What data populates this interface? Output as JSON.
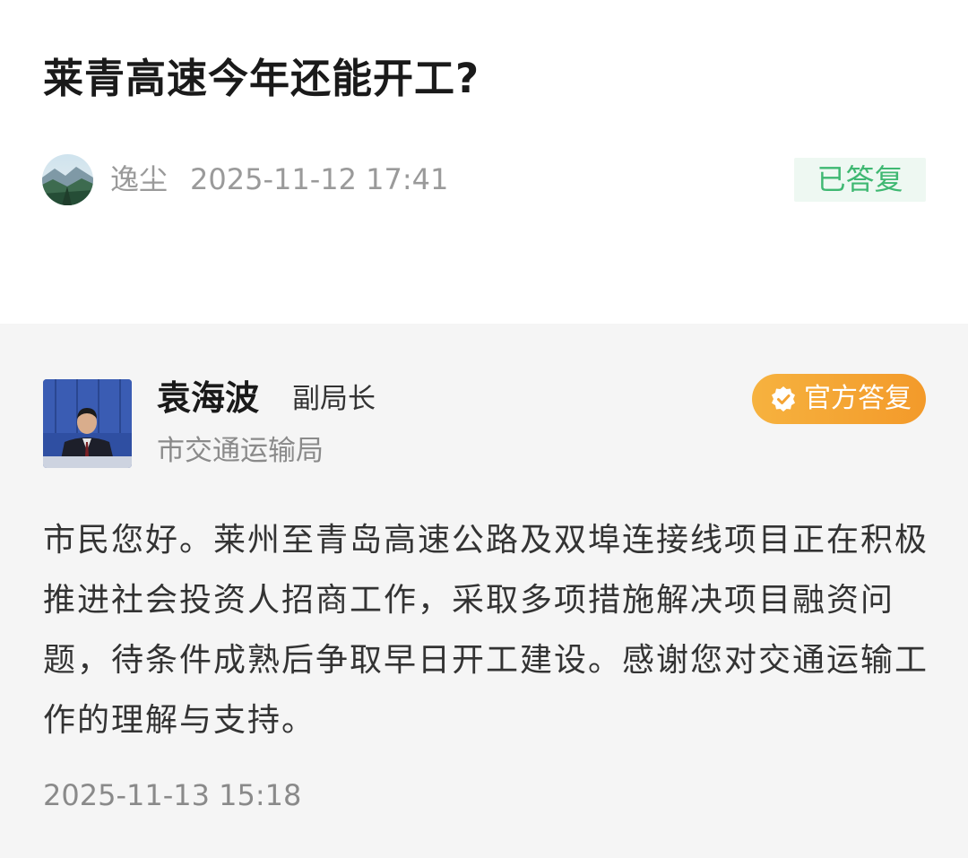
{
  "question": {
    "title": "莱青高速今年还能开工?",
    "author": "逸尘",
    "time": "2025-11-12 17:41",
    "status": "已答复"
  },
  "answer": {
    "name": "袁海波",
    "role": "副局长",
    "department": "市交通运输局",
    "badge": "官方答复",
    "badge_icon": "verified-check-icon",
    "body": "市民您好。莱州至青岛高速公路及双埠连接线项目正在积极推进社会投资人招商工作，采取多项措施解决项目融资问题，待条件成熟后争取早日开工建设。感谢您对交通运输工作的理解与支持。",
    "time": "2025-11-13 15:18"
  },
  "colors": {
    "status_text": "#3fb872",
    "status_bg": "#eef8f2",
    "badge_start": "#f6b23f",
    "badge_end": "#f39a2a",
    "answer_bg": "#f5f5f5"
  }
}
